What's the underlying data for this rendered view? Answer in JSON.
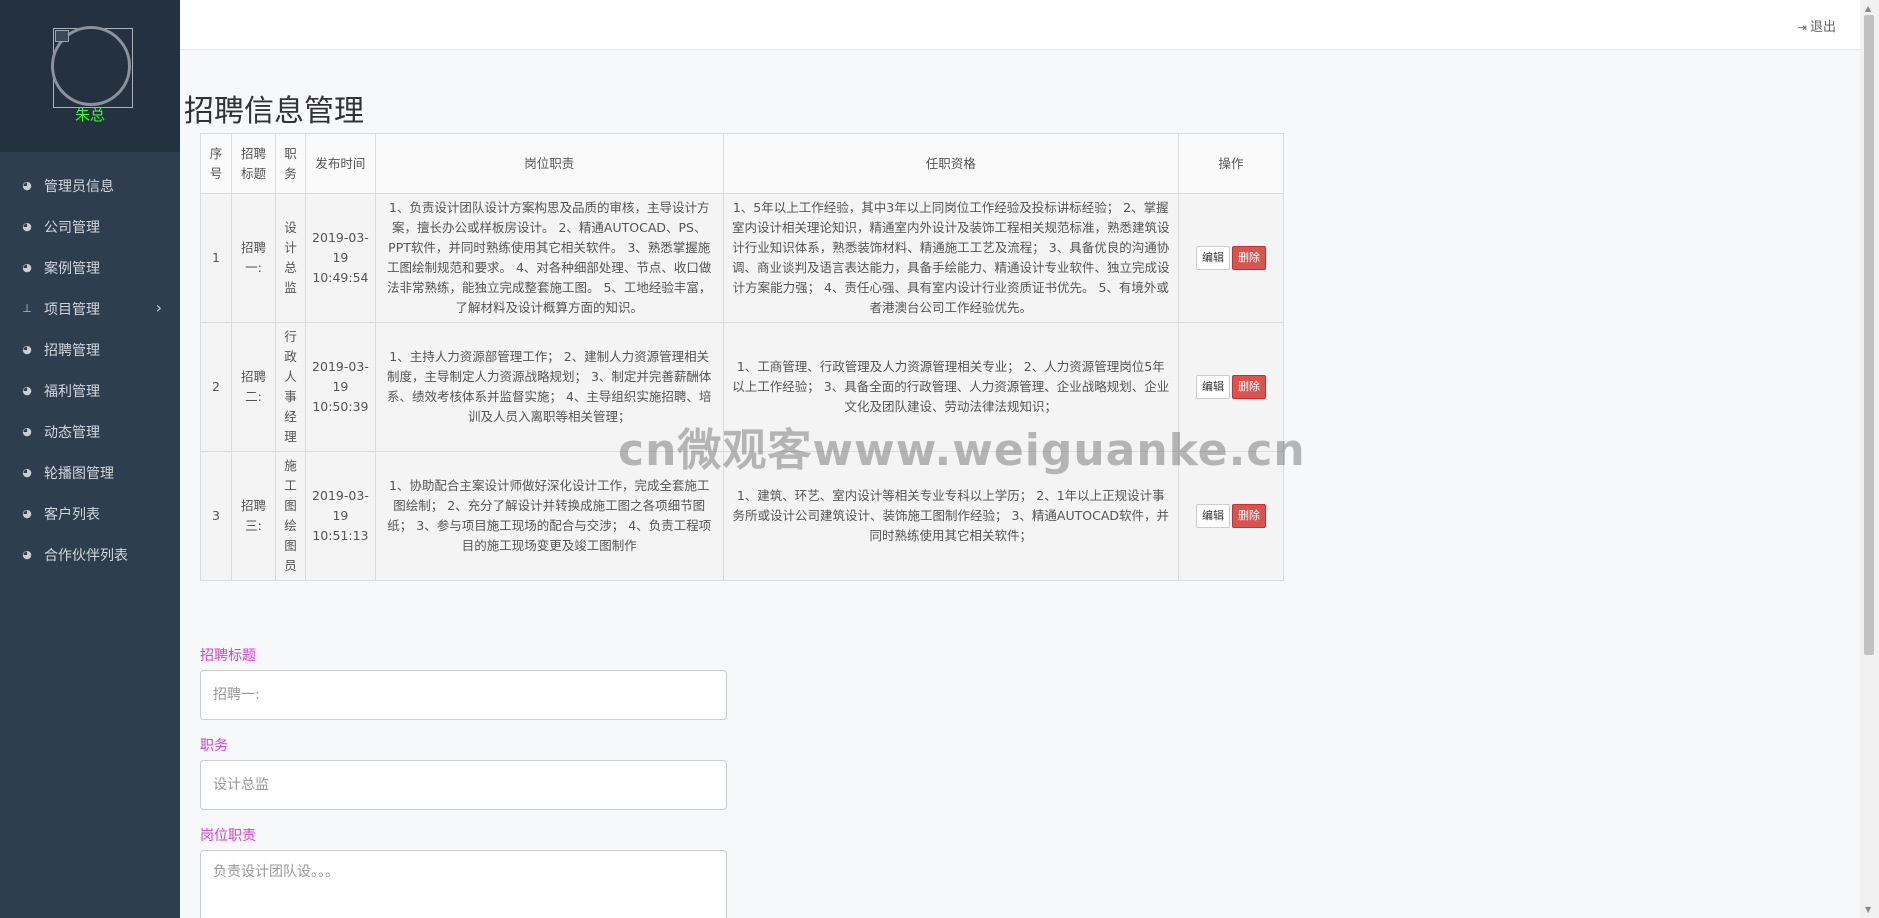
{
  "profile": {
    "name": "朱总"
  },
  "header": {
    "logout_label": "退出"
  },
  "sidebar": {
    "items": [
      {
        "label": "管理员信息",
        "icon": "dashboard-icon"
      },
      {
        "label": "公司管理",
        "icon": "dashboard-icon"
      },
      {
        "label": "案例管理",
        "icon": "dashboard-icon"
      },
      {
        "label": "项目管理",
        "icon": "pin-icon",
        "has_submenu": true
      },
      {
        "label": "招聘管理",
        "icon": "dashboard-icon"
      },
      {
        "label": "福利管理",
        "icon": "dashboard-icon"
      },
      {
        "label": "动态管理",
        "icon": "dashboard-icon"
      },
      {
        "label": "轮播图管理",
        "icon": "dashboard-icon"
      },
      {
        "label": "客户列表",
        "icon": "dashboard-icon"
      },
      {
        "label": "合作伙伴列表",
        "icon": "dashboard-icon"
      }
    ]
  },
  "page": {
    "title": "招聘信息管理"
  },
  "table": {
    "headers": [
      "序号",
      "招聘标题",
      "职务",
      "发布时间",
      "岗位职责",
      "任职资格",
      "操作"
    ],
    "edit_label": "编辑",
    "delete_label": "删除",
    "rows": [
      {
        "index": "1",
        "title": "招聘一:",
        "position": "设计总监",
        "time": "2019-03-19 10:49:54",
        "duties": "1、负责设计团队设计方案构思及品质的审核，主导设计方案，擅长办公或样板房设计。 2、精通AUTOCAD、PS、PPT软件，并同时熟练使用其它相关软件。 3、熟悉掌握施工图绘制规范和要求。 4、对各种细部处理、节点、收口做法非常熟练，能独立完成整套施工图。 5、工地经验丰富，了解材料及设计概算方面的知识。",
        "qualifications": "1、5年以上工作经验，其中3年以上同岗位工作经验及投标讲标经验； 2、掌握室内设计相关理论知识，精通室内外设计及装饰工程相关规范标准，熟悉建筑设计行业知识体系，熟悉装饰材料、精通施工工艺及流程； 3、具备优良的沟通协调、商业谈判及语言表达能力，具备手绘能力、精通设计专业软件、独立完成设计方案能力强； 4、责任心强、具有室内设计行业资质证书优先。 5、有境外或者港澳台公司工作经验优先。"
      },
      {
        "index": "2",
        "title": "招聘二:",
        "position": "行政人事经理",
        "time": "2019-03-19 10:50:39",
        "duties": "1、主持人力资源部管理工作； 2、建制人力资源管理相关制度，主导制定人力资源战略规划； 3、制定并完善薪酬体系、绩效考核体系并监督实施； 4、主导组织实施招聘、培训及人员入离职等相关管理；",
        "qualifications": "1、工商管理、行政管理及人力资源管理相关专业； 2、人力资源管理岗位5年以上工作经验； 3、具备全面的行政管理、人力资源管理、企业战略规划、企业文化及团队建设、劳动法律法规知识；"
      },
      {
        "index": "3",
        "title": "招聘三:",
        "position": "施工图绘图员",
        "time": "2019-03-19 10:51:13",
        "duties": "1、协助配合主案设计师做好深化设计工作，完成全套施工图绘制； 2、充分了解设计并转换成施工图之各项细节图纸； 3、参与项目施工现场的配合与交涉； 4、负责工程项目的施工现场变更及竣工图制作",
        "qualifications": "1、建筑、环艺、室内设计等相关专业专科以上学历； 2、1年以上正规设计事务所或设计公司建筑设计、装饰施工图制作经验； 3、精通AUTOCAD软件，并同时熟练使用其它相关软件；"
      }
    ]
  },
  "watermark": "cn微观客www.weiguanke.cn",
  "form": {
    "title_label": "招聘标题",
    "title_placeholder": "招聘一:",
    "position_label": "职务",
    "position_placeholder": "设计总监",
    "duties_label": "岗位职责",
    "duties_placeholder": "负责设计团队设。。。"
  }
}
